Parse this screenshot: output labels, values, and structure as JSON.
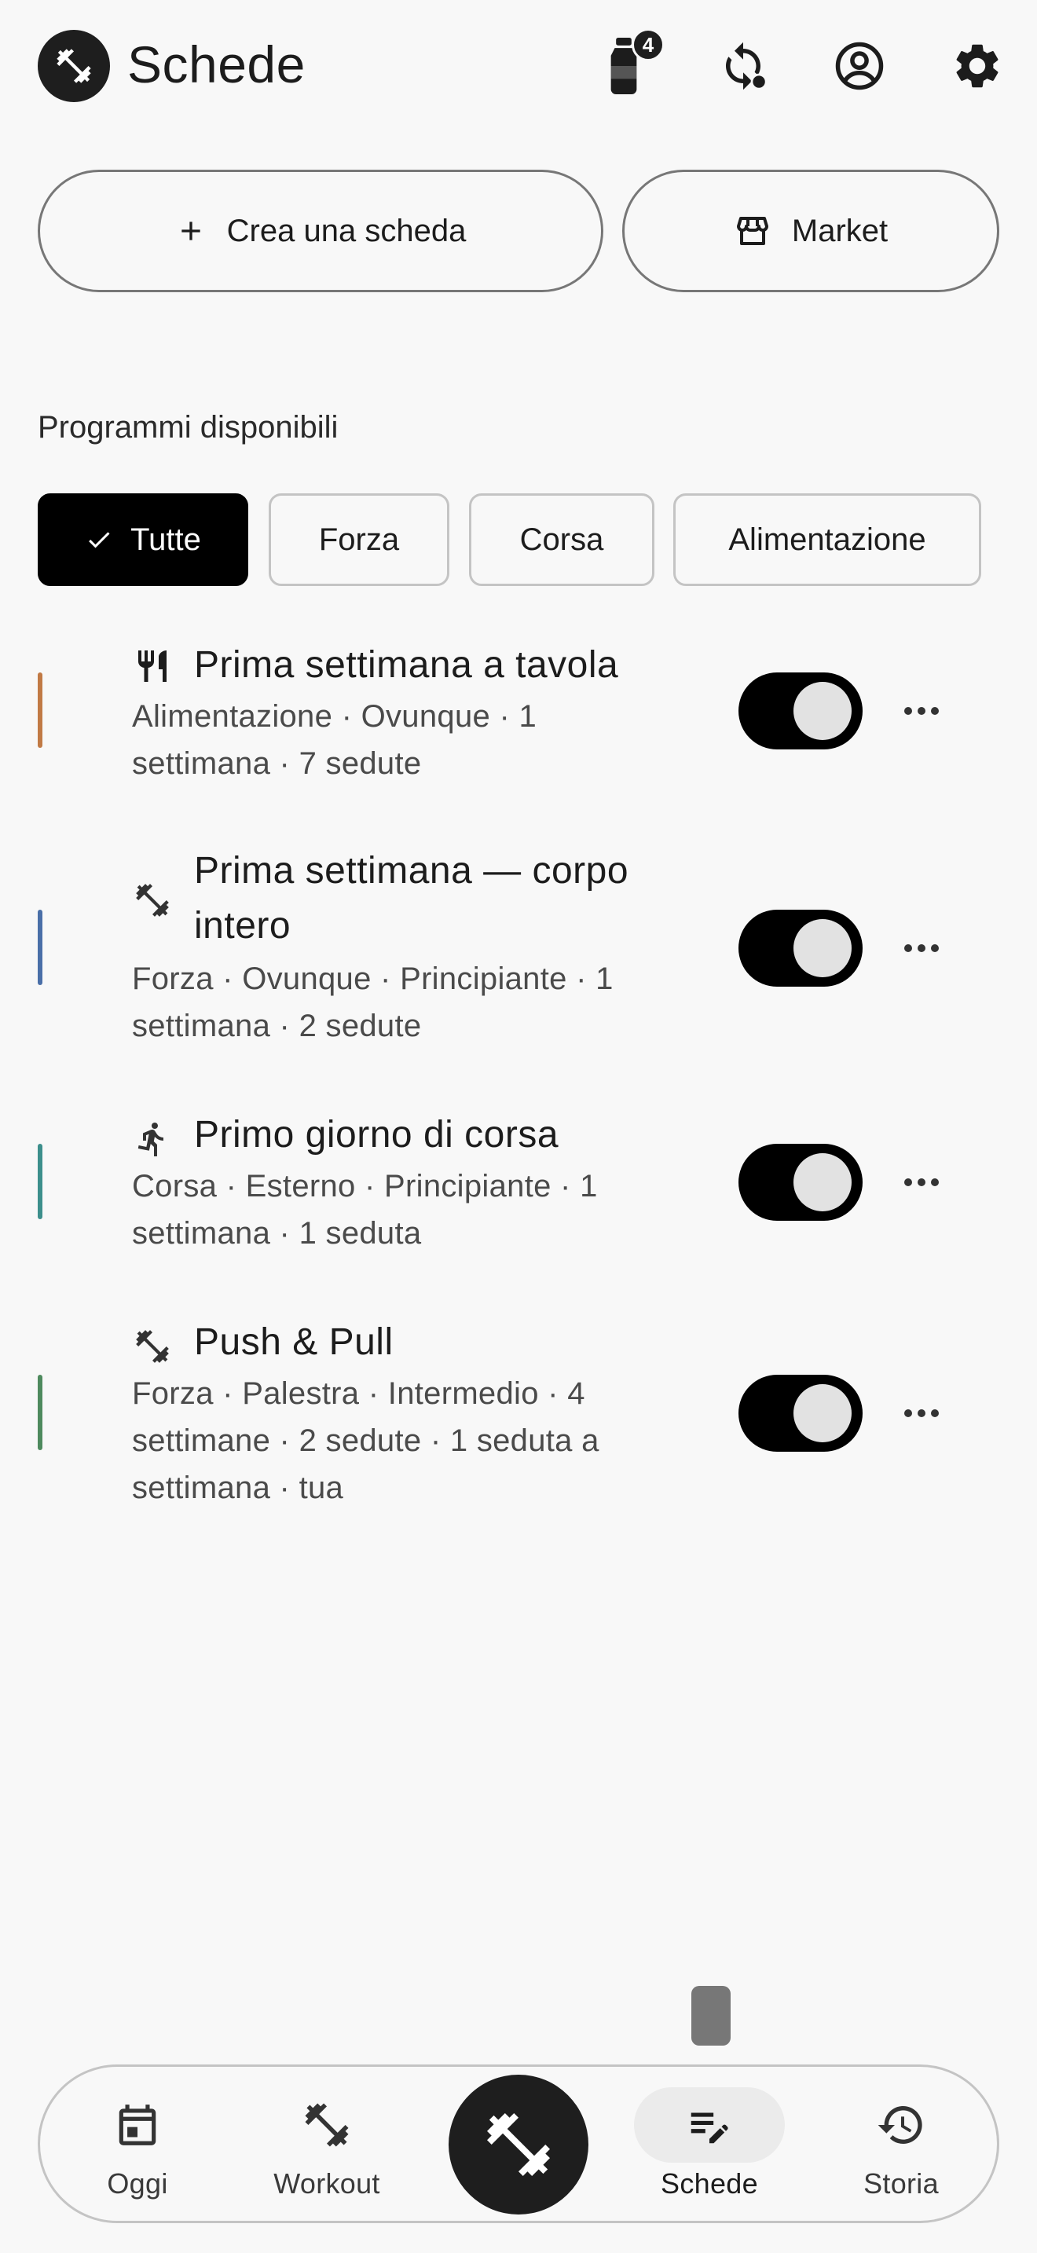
{
  "header": {
    "title": "Schede",
    "water_badge_count": "4",
    "icons": [
      "barbell-logo-icon",
      "water-bottle-icon",
      "sync-icon",
      "account-icon",
      "settings-icon"
    ]
  },
  "actions": {
    "create_label": "Crea una scheda",
    "market_label": "Market"
  },
  "section": {
    "label": "Programmi disponibili"
  },
  "filters": [
    {
      "label": "Tutte",
      "selected": true
    },
    {
      "label": "Forza",
      "selected": false
    },
    {
      "label": "Corsa",
      "selected": false
    },
    {
      "label": "Alimentazione",
      "selected": false
    }
  ],
  "programs": [
    {
      "title": "Prima settimana a tavola",
      "meta": "Alimentazione · Ovunque · 1 settimana · 7 sedute",
      "icon": "fork-knife-icon",
      "accent": "#c17a45",
      "enabled": true
    },
    {
      "title": "Prima settimana — corpo intero",
      "meta": "Forza · Ovunque · Principiante · 1 settimana · 2 sedute",
      "icon": "dumbbell-icon",
      "accent": "#4a6fa8",
      "enabled": true
    },
    {
      "title": "Primo giorno di corsa",
      "meta": "Corsa · Esterno · Principiante · 1 settimana · 1 seduta",
      "icon": "runner-icon",
      "accent": "#3d8f8c",
      "enabled": true
    },
    {
      "title": "Push & Pull",
      "meta": "Forza · Palestra · Intermedio · 4 settimane · 2 sedute · 1 seduta a settimana · tua",
      "icon": "dumbbell-icon",
      "accent": "#4e8a5e",
      "enabled": true
    }
  ],
  "nav": {
    "items": [
      {
        "label": "Oggi",
        "icon": "calendar-icon"
      },
      {
        "label": "Workout",
        "icon": "dumbbell-icon"
      },
      {
        "label": "Schede",
        "icon": "edit-list-icon",
        "active": true
      },
      {
        "label": "Storia",
        "icon": "history-icon"
      }
    ],
    "fab_icon": "barbell-icon"
  }
}
